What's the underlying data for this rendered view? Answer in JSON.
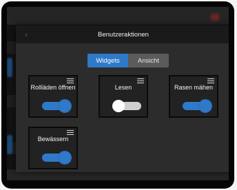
{
  "dialog": {
    "title": "Benutzeraktionen",
    "tabs": [
      {
        "label": "Widgets",
        "active": true
      },
      {
        "label": "Ansicht",
        "active": false
      }
    ]
  },
  "widgets": [
    {
      "label": "Rollläden öffnen",
      "toggle_on": true
    },
    {
      "label": "Lesen",
      "toggle_on": false
    },
    {
      "label": "Rasen mähen",
      "toggle_on": true
    },
    {
      "label": "Bewässern",
      "toggle_on": true
    }
  ],
  "colors": {
    "accent": "#2f79c9",
    "dialog_bg": "#2c2c2c",
    "header_bg": "#1a1a1a",
    "widget_bg": "#222222",
    "tab_inactive": "#5b5b5b"
  },
  "icons": {
    "back": "chevron-left-icon",
    "widget_menu": "hamburger-menu-icon"
  }
}
